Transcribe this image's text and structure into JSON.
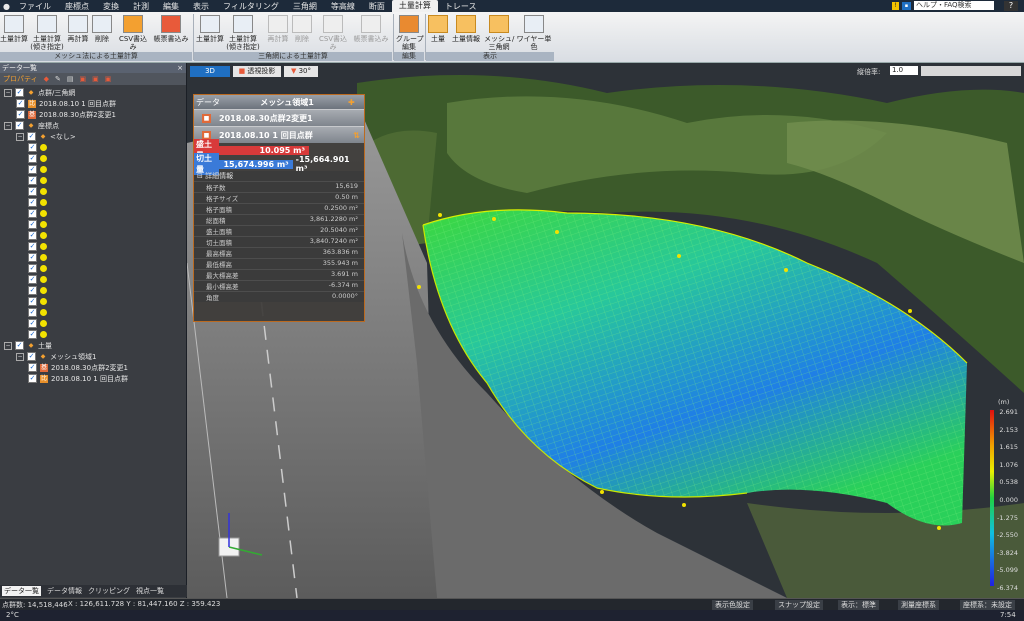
{
  "menu": {
    "items": [
      "ファイル",
      "座標点",
      "変換",
      "計測",
      "編集",
      "表示",
      "フィルタリング",
      "三角網",
      "等高線",
      "断面",
      "土量計算",
      "トレース"
    ],
    "active_index": 10,
    "help_label": "ヘルプ・FAQ検索",
    "help_icon": "!",
    "question": "?"
  },
  "ribbon": {
    "buttons": [
      {
        "label": "土量計算",
        "icon": "grid-calc"
      },
      {
        "label": "土量計算\n(傾き指定)",
        "icon": "grid-tilt"
      },
      {
        "label": "再計算",
        "icon": "recalc"
      },
      {
        "label": "削除",
        "icon": "delete"
      },
      {
        "label": "CSV書込み",
        "icon": "csv"
      },
      {
        "label": "帳票書込み",
        "icon": "report"
      },
      {
        "label": "土量計算",
        "icon": "tri-calc"
      },
      {
        "label": "土量計算\n(傾き指定)",
        "icon": "tri-tilt"
      },
      {
        "label": "再計算",
        "icon": "recalc2"
      },
      {
        "label": "削除",
        "icon": "delete2"
      },
      {
        "label": "CSV書込み",
        "icon": "csv2"
      },
      {
        "label": "帳票書込み",
        "icon": "report2"
      },
      {
        "label": "グループ\n編集",
        "icon": "group-edit"
      },
      {
        "label": "土量",
        "icon": "volume"
      },
      {
        "label": "土量情報",
        "icon": "volume-info"
      },
      {
        "label": "メッシュ/\n三角網",
        "icon": "mesh-tin"
      },
      {
        "label": "ワイヤー単色",
        "icon": "wire"
      }
    ],
    "groups": [
      "メッシュ法による土量計算",
      "三角網による土量計算",
      "編集",
      "表示"
    ]
  },
  "left_panel": {
    "title": "データ一覧",
    "close": "×",
    "toolbar": "プロパティ",
    "tree": [
      {
        "level": 0,
        "label": "点群/三角網",
        "type": "folder"
      },
      {
        "level": 1,
        "label": "2018.08.10 1 回目点群",
        "type": "doc",
        "badge": "比"
      },
      {
        "level": 1,
        "label": "2018.08.30点群2変更1",
        "type": "doc",
        "badge": "基"
      },
      {
        "level": 0,
        "label": "座標点",
        "type": "folder"
      },
      {
        "level": 1,
        "label": "<なし>",
        "type": "folder"
      },
      {
        "level": 2,
        "label": "",
        "type": "dot"
      },
      {
        "level": 2,
        "label": "",
        "type": "dot"
      },
      {
        "level": 2,
        "label": "",
        "type": "dot"
      },
      {
        "level": 2,
        "label": "",
        "type": "dot"
      },
      {
        "level": 2,
        "label": "",
        "type": "dot"
      },
      {
        "level": 2,
        "label": "",
        "type": "dot"
      },
      {
        "level": 2,
        "label": "",
        "type": "dot"
      },
      {
        "level": 2,
        "label": "",
        "type": "dot"
      },
      {
        "level": 2,
        "label": "",
        "type": "dot"
      },
      {
        "level": 2,
        "label": "",
        "type": "dot"
      },
      {
        "level": 2,
        "label": "",
        "type": "dot"
      },
      {
        "level": 2,
        "label": "",
        "type": "dot"
      },
      {
        "level": 2,
        "label": "",
        "type": "dot"
      },
      {
        "level": 2,
        "label": "",
        "type": "dot"
      },
      {
        "level": 2,
        "label": "",
        "type": "dot"
      },
      {
        "level": 2,
        "label": "",
        "type": "dot"
      },
      {
        "level": 2,
        "label": "",
        "type": "dot"
      },
      {
        "level": 2,
        "label": "",
        "type": "dot"
      },
      {
        "level": 0,
        "label": "土量",
        "type": "folder"
      },
      {
        "level": 1,
        "label": "メッシュ領域1",
        "type": "folder"
      },
      {
        "level": 2,
        "label": "2018.08.30点群2変更1",
        "type": "doc",
        "badge": "基"
      },
      {
        "level": 2,
        "label": "2018.08.10 1 回目点群",
        "type": "doc",
        "badge": "比"
      }
    ],
    "tabs": [
      "データ一覧",
      "データ情報",
      "クリッピング",
      "視点一覧"
    ]
  },
  "view_toolbar": {
    "mode": "3D",
    "projection": "透視投影",
    "angle": "30°",
    "scale_label": "縦倍率:",
    "scale_value": "1.0"
  },
  "data_panel": {
    "header_label": "データ",
    "header_name": "メッシュ領域1",
    "base": "2018.08.30点群2変更1",
    "compare": "2018.08.10 1 回目点群",
    "fill_label": "盛土量",
    "fill_value": "10.095 m³",
    "cut_label": "切土量",
    "cut_value": "15,674.996 m³",
    "net_value": "-15,664.901 m³",
    "detail_title": "詳細情報",
    "details": [
      {
        "k": "格子数",
        "v": "15,619"
      },
      {
        "k": "格子サイズ",
        "v": "0.50 m"
      },
      {
        "k": "格子面積",
        "v": "0.2500 m²"
      },
      {
        "k": "総面積",
        "v": "3,861.2280 m²"
      },
      {
        "k": "盛土面積",
        "v": "20.5040 m²"
      },
      {
        "k": "切土面積",
        "v": "3,840.7240 m²"
      },
      {
        "k": "最高標高",
        "v": "363.836 m"
      },
      {
        "k": "最低標高",
        "v": "355.943 m"
      },
      {
        "k": "最大標高差",
        "v": "3.691 m"
      },
      {
        "k": "最小標高差",
        "v": "-6.374 m"
      },
      {
        "k": "角度",
        "v": "0.0000°"
      }
    ]
  },
  "color_scale": {
    "unit": "(m)",
    "ticks": [
      "2.691",
      "2.153",
      "1.615",
      "1.076",
      "0.538",
      "0.000",
      "-1.275",
      "-2.550",
      "-3.824",
      "-5.099",
      "-6.374"
    ]
  },
  "status_bar": {
    "point_count": "点群数: 14,518,446",
    "coords": "X : 126,611.728  Y : 81,447.160  Z : 359.423",
    "items": [
      "表示色設定",
      "スナップ設定",
      "表示：標準",
      "測量座標系",
      "座標系：未設定"
    ]
  },
  "taskbar": {
    "temp": "2°C",
    "time": "7:54"
  }
}
